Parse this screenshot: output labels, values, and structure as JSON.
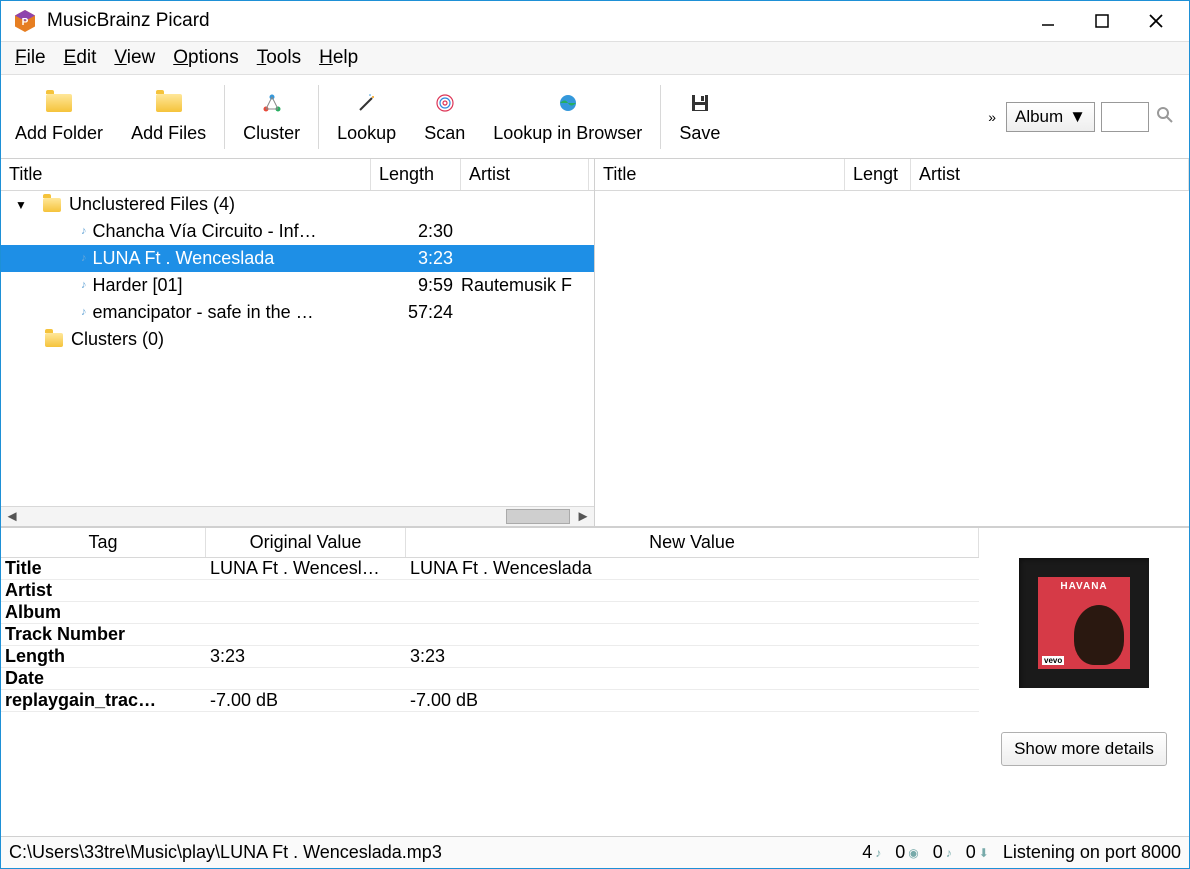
{
  "window": {
    "title": "MusicBrainz Picard"
  },
  "menu": {
    "file": "File",
    "edit": "Edit",
    "view": "View",
    "options": "Options",
    "tools": "Tools",
    "help": "Help"
  },
  "toolbar": {
    "add_folder": "Add Folder",
    "add_files": "Add Files",
    "cluster": "Cluster",
    "lookup": "Lookup",
    "scan": "Scan",
    "lookup_browser": "Lookup in Browser",
    "save": "Save",
    "overflow": "»",
    "search_mode": "Album"
  },
  "left_cols": {
    "title": "Title",
    "length": "Length",
    "artist": "Artist",
    "w_title": 370,
    "w_length": 90,
    "w_artist": 128
  },
  "right_cols": {
    "title": "Title",
    "length": "Lengt",
    "artist": "Artist",
    "w_title": 250,
    "w_length": 66,
    "w_artist": 260
  },
  "tree": {
    "unclustered_label": "Unclustered Files (4)",
    "clusters_label": "Clusters (0)",
    "files": [
      {
        "title": "Chancha Vía Circuito - Inf…",
        "length": "2:30",
        "artist": "",
        "selected": false
      },
      {
        "title": "LUNA Ft . Wenceslada",
        "length": "3:23",
        "artist": "",
        "selected": true
      },
      {
        "title": "Harder [01]",
        "length": "9:59",
        "artist": "Rautemusik F",
        "selected": false
      },
      {
        "title": "emancipator - safe in the …",
        "length": "57:24",
        "artist": "",
        "selected": false
      }
    ]
  },
  "tag_headers": {
    "tag": "Tag",
    "orig": "Original Value",
    "new": "New Value"
  },
  "tags": [
    {
      "name": "Title",
      "orig": "LUNA Ft . Wencesl…",
      "new": "LUNA Ft . Wenceslada"
    },
    {
      "name": "Artist",
      "orig": "",
      "new": ""
    },
    {
      "name": "Album",
      "orig": "",
      "new": ""
    },
    {
      "name": "Track Number",
      "orig": "",
      "new": ""
    },
    {
      "name": "Length",
      "orig": "3:23",
      "new": "3:23"
    },
    {
      "name": "Date",
      "orig": "",
      "new": ""
    },
    {
      "name": "replaygain_trac…",
      "orig": "-7.00 dB",
      "new": "-7.00 dB"
    }
  ],
  "cover": {
    "label": "HAVANA",
    "badge": "vevo"
  },
  "details_btn": "Show more details",
  "status": {
    "path": "C:\\Users\\33tre\\Music\\play\\LUNA Ft . Wenceslada.mp3",
    "c1": "4",
    "c2": "0",
    "c3": "0",
    "c4": "0",
    "listening": "Listening on port 8000"
  }
}
